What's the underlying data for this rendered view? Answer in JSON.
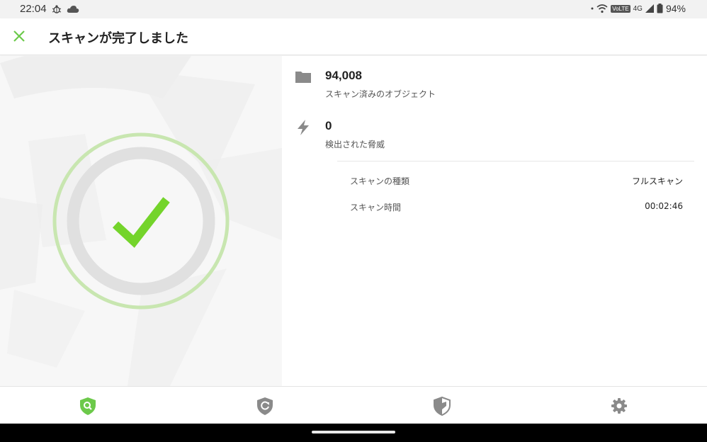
{
  "status_bar": {
    "time": "22:04",
    "network": "4G",
    "volte": "VoLTE",
    "battery": "94%"
  },
  "app_bar": {
    "title": "スキャンが完了しました",
    "close_icon": "close-icon"
  },
  "results": {
    "objects": {
      "value": "94,008",
      "label": "スキャン済みのオブジェクト",
      "icon": "folder-icon"
    },
    "threats": {
      "value": "0",
      "label": "検出された脅威",
      "icon": "lightning-icon"
    }
  },
  "details": [
    {
      "label": "スキャンの種類",
      "value": "フルスキャン"
    },
    {
      "label": "スキャン時間",
      "value": "00:02:46"
    }
  ],
  "bottom_nav": [
    {
      "name": "scanner",
      "icon": "shield-search-icon",
      "active": true
    },
    {
      "name": "update",
      "icon": "shield-refresh-icon",
      "active": false
    },
    {
      "name": "security",
      "icon": "shield-half-icon",
      "active": false
    },
    {
      "name": "settings",
      "icon": "gear-icon",
      "active": false
    }
  ],
  "colors": {
    "accent": "#6cc94a",
    "check": "#74d42b",
    "ring_outer": "#c8e6b0",
    "ring_inner": "#e0e0e0",
    "icon_gray": "#8a8a8a"
  }
}
